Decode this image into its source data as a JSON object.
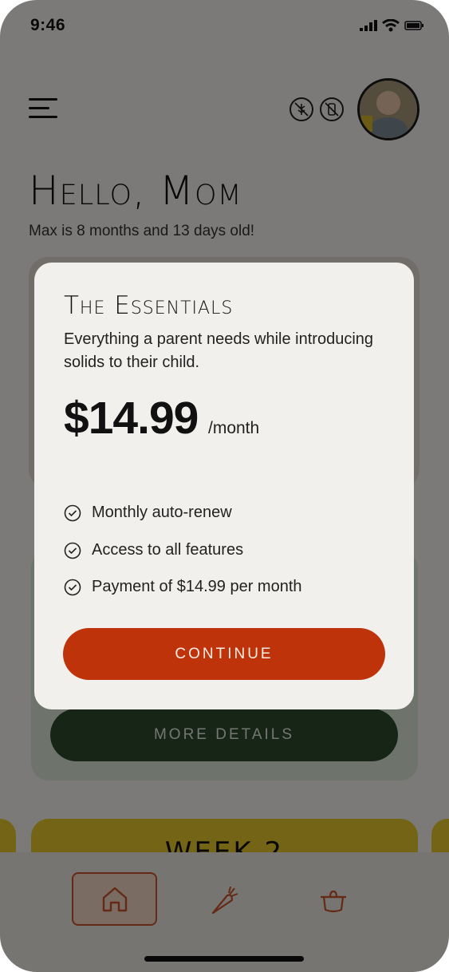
{
  "status_bar": {
    "time": "9:46"
  },
  "header": {
    "greeting": "Hello, Mom",
    "subtitle": "Max is 8 months and 13 days old!"
  },
  "background": {
    "more_details_label": "MORE DETAILS",
    "week_label": "WEEK 2"
  },
  "plan_modal": {
    "title": "The Essentials",
    "description": "Everything a parent needs while introducing solids to their child.",
    "price": "$14.99",
    "price_unit": "/month",
    "features": [
      "Monthly auto-renew",
      "Access to all features",
      "Payment of $14.99 per month"
    ],
    "continue_label": "CONTINUE"
  },
  "bottom_nav": {
    "items": [
      {
        "icon": "home-icon",
        "active": true
      },
      {
        "icon": "carrot-icon",
        "active": false
      },
      {
        "icon": "pot-icon",
        "active": false
      }
    ]
  },
  "colors": {
    "accent": "#bf330a",
    "dark_green": "#2c4a2a",
    "yellow": "#e8c92a",
    "modal_bg": "#f2f0ec"
  }
}
